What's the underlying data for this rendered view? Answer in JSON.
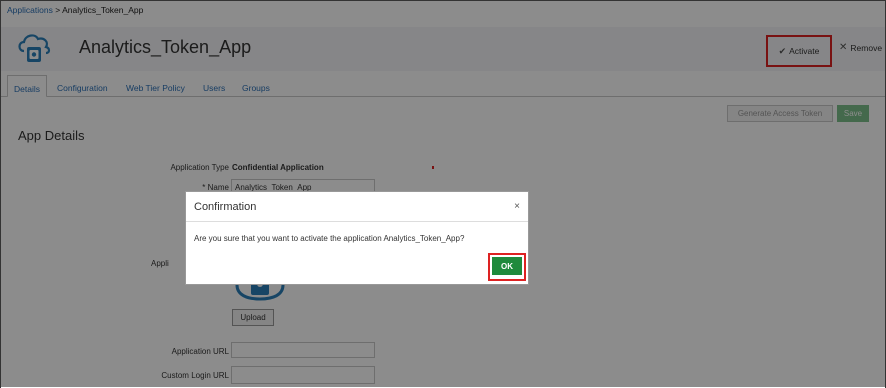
{
  "breadcrumb": {
    "link": "Applications",
    "separator": ">",
    "current": "Analytics_Token_App"
  },
  "header": {
    "title": "Analytics_Token_App",
    "activate_label": "Activate",
    "remove_label": "Remove"
  },
  "tabs": [
    {
      "label": "Details",
      "active": true
    },
    {
      "label": "Configuration"
    },
    {
      "label": "Web Tier Policy"
    },
    {
      "label": "Users"
    },
    {
      "label": "Groups"
    }
  ],
  "toolbar": {
    "generate_token_label": "Generate Access Token",
    "save_label": "Save"
  },
  "section_title": "App Details",
  "form": {
    "app_type_label": "Application Type",
    "app_type_value": "Confidential Application",
    "name_label": "Name",
    "name_required_marker": "*",
    "name_value": "Analytics_Token_App",
    "app_icon_label": "Appli",
    "upload_label": "Upload",
    "app_url_label": "Application URL",
    "app_url_value": "",
    "custom_login_label": "Custom Login URL",
    "custom_login_value": ""
  },
  "dialog": {
    "title": "Confirmation",
    "close_glyph": "×",
    "message": "Are you sure that you want to activate the application Analytics_Token_App?",
    "ok_label": "OK"
  },
  "icons": {
    "app": "cloud-app-icon",
    "activate": "check-circle-icon",
    "remove": "close-icon"
  },
  "colors": {
    "link": "#2b6fb5",
    "highlight": "#dd2222",
    "ok_button": "#1e8a3c",
    "save_button": "#7cc08a"
  }
}
